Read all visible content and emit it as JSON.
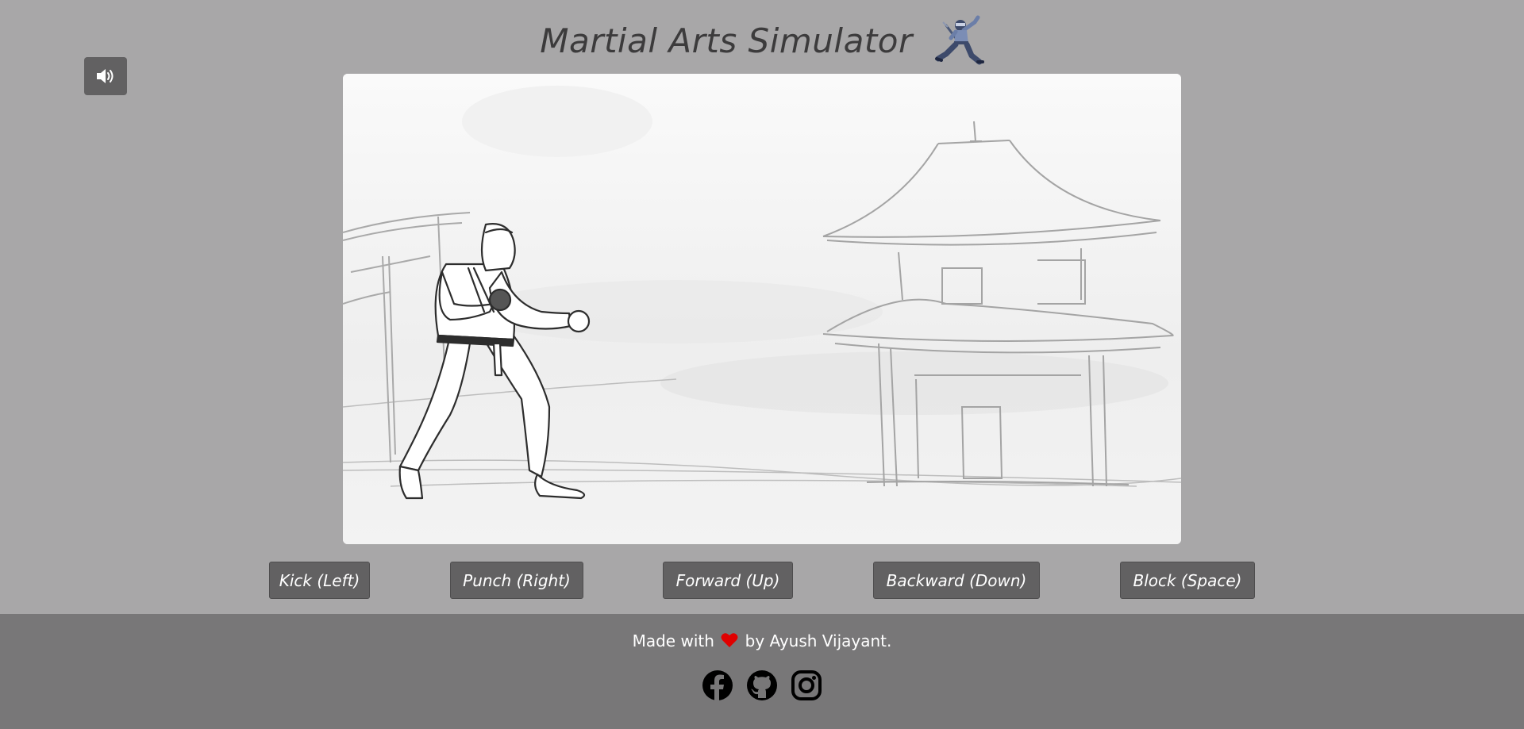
{
  "header": {
    "title": "Martial Arts Simulator"
  },
  "sound_button": {
    "icon": "volume-icon"
  },
  "controls": [
    {
      "label": "Kick (Left)"
    },
    {
      "label": "Punch (Right)"
    },
    {
      "label": "Forward (Up)"
    },
    {
      "label": "Backward (Down)"
    },
    {
      "label": "Block (Space)"
    }
  ],
  "footer": {
    "made_with_prefix": "Made with",
    "made_with_suffix": "by Ayush Vijayant.",
    "socials": [
      {
        "icon": "facebook-icon"
      },
      {
        "icon": "github-icon"
      },
      {
        "icon": "instagram-icon"
      }
    ]
  },
  "colors": {
    "background": "#a8a7a8",
    "button": "#626162",
    "footer": "#787778",
    "heart": "#e00000",
    "title": "#3c3b3c"
  }
}
